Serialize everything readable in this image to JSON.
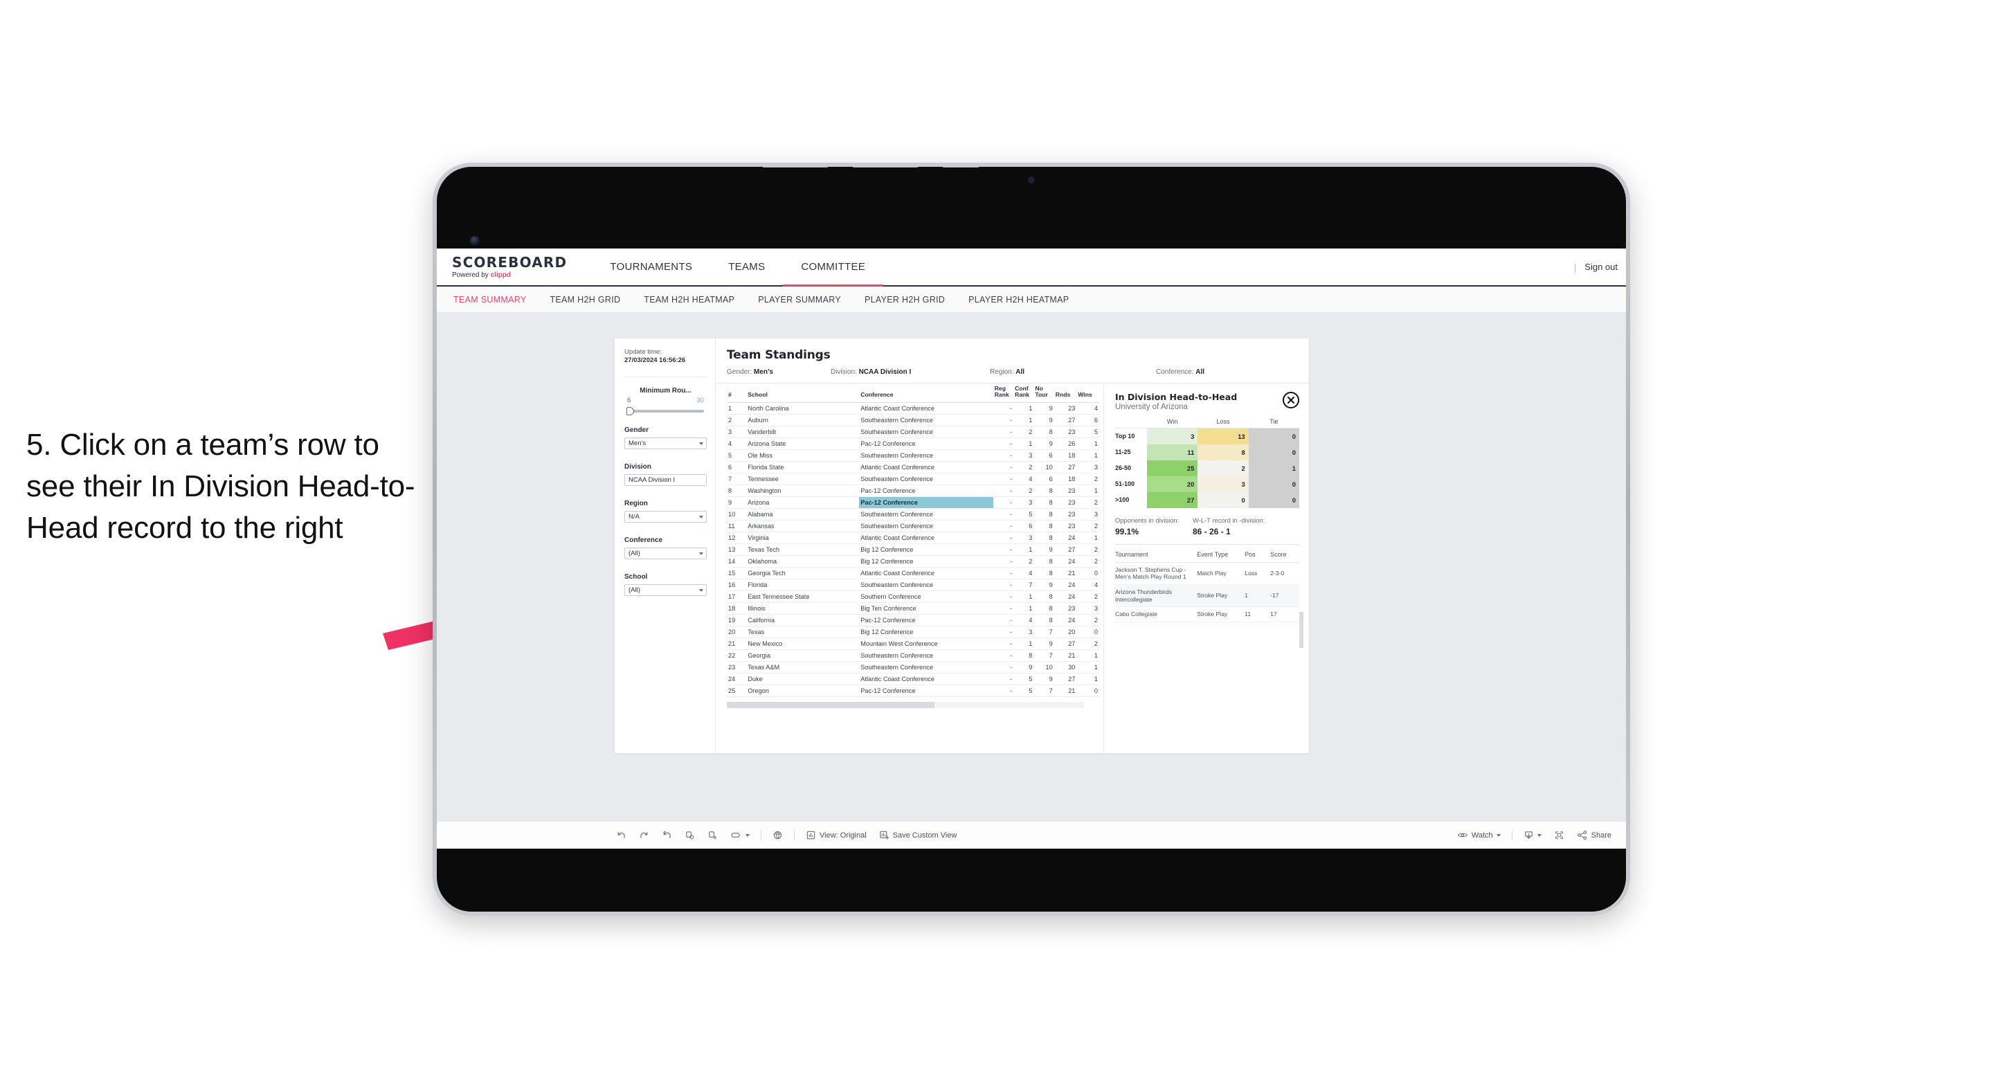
{
  "caption": "5. Click on a team’s row to see their In Division Head-to-Head record to the right",
  "app": {
    "brand": {
      "name": "SCOREBOARD",
      "powered_prefix": "Powered by ",
      "powered_by": "clippd"
    },
    "top_nav": [
      {
        "label": "TOURNAMENTS",
        "active": false
      },
      {
        "label": "TEAMS",
        "active": false
      },
      {
        "label": "COMMITTEE",
        "active": true
      }
    ],
    "sign_out": "Sign out",
    "sub_nav": [
      {
        "label": "TEAM SUMMARY",
        "active": true
      },
      {
        "label": "TEAM H2H GRID",
        "active": false
      },
      {
        "label": "TEAM H2H HEATMAP",
        "active": false
      },
      {
        "label": "PLAYER SUMMARY",
        "active": false
      },
      {
        "label": "PLAYER H2H GRID",
        "active": false
      },
      {
        "label": "PLAYER H2H HEATMAP",
        "active": false
      }
    ]
  },
  "filters": {
    "update_label": "Update time:",
    "update_time": "27/03/2024 16:56:26",
    "slider": {
      "title": "Minimum Rou...",
      "min": "6",
      "max": "30"
    },
    "fields": [
      {
        "label": "Gender",
        "value": "Men’s"
      },
      {
        "label": "Division",
        "value": "NCAA Division I"
      },
      {
        "label": "Region",
        "value": "N/A"
      },
      {
        "label": "Conference",
        "value": "(All)"
      },
      {
        "label": "School",
        "value": "(All)"
      }
    ]
  },
  "standings": {
    "title": "Team Standings",
    "meta": [
      {
        "label": "Gender: ",
        "value": "Men’s"
      },
      {
        "label": "Division: ",
        "value": "NCAA Division I"
      },
      {
        "label": "Region: ",
        "value": "All"
      },
      {
        "label": "Conference: ",
        "value": "All"
      }
    ],
    "columns": [
      "#",
      "School",
      "Conference",
      "Reg Rank",
      "Conf Rank",
      "No Tour",
      "Rnds",
      "Wins"
    ],
    "rows": [
      {
        "rank": "1",
        "school": "North Carolina",
        "conference": "Atlantic Coast Conference",
        "reg_rank": "-",
        "conf_rank": "1",
        "no_tour": "9",
        "rnds": "23",
        "wins": "4",
        "selected": false
      },
      {
        "rank": "2",
        "school": "Auburn",
        "conference": "Southeastern Conference",
        "reg_rank": "-",
        "conf_rank": "1",
        "no_tour": "9",
        "rnds": "27",
        "wins": "6",
        "selected": false
      },
      {
        "rank": "3",
        "school": "Vanderbilt",
        "conference": "Southeastern Conference",
        "reg_rank": "-",
        "conf_rank": "2",
        "no_tour": "8",
        "rnds": "23",
        "wins": "5",
        "selected": false
      },
      {
        "rank": "4",
        "school": "Arizona State",
        "conference": "Pac-12 Conference",
        "reg_rank": "-",
        "conf_rank": "1",
        "no_tour": "9",
        "rnds": "26",
        "wins": "1",
        "selected": false
      },
      {
        "rank": "5",
        "school": "Ole Miss",
        "conference": "Southeastern Conference",
        "reg_rank": "-",
        "conf_rank": "3",
        "no_tour": "6",
        "rnds": "18",
        "wins": "1",
        "selected": false
      },
      {
        "rank": "6",
        "school": "Florida State",
        "conference": "Atlantic Coast Conference",
        "reg_rank": "-",
        "conf_rank": "2",
        "no_tour": "10",
        "rnds": "27",
        "wins": "3",
        "selected": false
      },
      {
        "rank": "7",
        "school": "Tennessee",
        "conference": "Southeastern Conference",
        "reg_rank": "-",
        "conf_rank": "4",
        "no_tour": "6",
        "rnds": "18",
        "wins": "2",
        "selected": false
      },
      {
        "rank": "8",
        "school": "Washington",
        "conference": "Pac-12 Conference",
        "reg_rank": "-",
        "conf_rank": "2",
        "no_tour": "8",
        "rnds": "23",
        "wins": "1",
        "selected": false
      },
      {
        "rank": "9",
        "school": "Arizona",
        "conference": "Pac-12 Conference",
        "reg_rank": "-",
        "conf_rank": "3",
        "no_tour": "8",
        "rnds": "23",
        "wins": "2",
        "selected": true
      },
      {
        "rank": "10",
        "school": "Alabama",
        "conference": "Southeastern Conference",
        "reg_rank": "-",
        "conf_rank": "5",
        "no_tour": "8",
        "rnds": "23",
        "wins": "3",
        "selected": false
      },
      {
        "rank": "11",
        "school": "Arkansas",
        "conference": "Southeastern Conference",
        "reg_rank": "-",
        "conf_rank": "6",
        "no_tour": "8",
        "rnds": "23",
        "wins": "2",
        "selected": false
      },
      {
        "rank": "12",
        "school": "Virginia",
        "conference": "Atlantic Coast Conference",
        "reg_rank": "-",
        "conf_rank": "3",
        "no_tour": "8",
        "rnds": "24",
        "wins": "1",
        "selected": false
      },
      {
        "rank": "13",
        "school": "Texas Tech",
        "conference": "Big 12 Conference",
        "reg_rank": "-",
        "conf_rank": "1",
        "no_tour": "9",
        "rnds": "27",
        "wins": "2",
        "selected": false
      },
      {
        "rank": "14",
        "school": "Oklahoma",
        "conference": "Big 12 Conference",
        "reg_rank": "-",
        "conf_rank": "2",
        "no_tour": "8",
        "rnds": "24",
        "wins": "2",
        "selected": false
      },
      {
        "rank": "15",
        "school": "Georgia Tech",
        "conference": "Atlantic Coast Conference",
        "reg_rank": "-",
        "conf_rank": "4",
        "no_tour": "8",
        "rnds": "21",
        "wins": "0",
        "selected": false
      },
      {
        "rank": "16",
        "school": "Florida",
        "conference": "Southeastern Conference",
        "reg_rank": "-",
        "conf_rank": "7",
        "no_tour": "9",
        "rnds": "24",
        "wins": "4",
        "selected": false
      },
      {
        "rank": "17",
        "school": "East Tennessee State",
        "conference": "Southern Conference",
        "reg_rank": "-",
        "conf_rank": "1",
        "no_tour": "8",
        "rnds": "24",
        "wins": "2",
        "selected": false
      },
      {
        "rank": "18",
        "school": "Illinois",
        "conference": "Big Ten Conference",
        "reg_rank": "-",
        "conf_rank": "1",
        "no_tour": "8",
        "rnds": "23",
        "wins": "3",
        "selected": false
      },
      {
        "rank": "19",
        "school": "California",
        "conference": "Pac-12 Conference",
        "reg_rank": "-",
        "conf_rank": "4",
        "no_tour": "8",
        "rnds": "24",
        "wins": "2",
        "selected": false
      },
      {
        "rank": "20",
        "school": "Texas",
        "conference": "Big 12 Conference",
        "reg_rank": "-",
        "conf_rank": "3",
        "no_tour": "7",
        "rnds": "20",
        "wins": "0",
        "selected": false
      },
      {
        "rank": "21",
        "school": "New Mexico",
        "conference": "Mountain West Conference",
        "reg_rank": "-",
        "conf_rank": "1",
        "no_tour": "9",
        "rnds": "27",
        "wins": "2",
        "selected": false
      },
      {
        "rank": "22",
        "school": "Georgia",
        "conference": "Southeastern Conference",
        "reg_rank": "-",
        "conf_rank": "8",
        "no_tour": "7",
        "rnds": "21",
        "wins": "1",
        "selected": false
      },
      {
        "rank": "23",
        "school": "Texas A&M",
        "conference": "Southeastern Conference",
        "reg_rank": "-",
        "conf_rank": "9",
        "no_tour": "10",
        "rnds": "30",
        "wins": "1",
        "selected": false
      },
      {
        "rank": "24",
        "school": "Duke",
        "conference": "Atlantic Coast Conference",
        "reg_rank": "-",
        "conf_rank": "5",
        "no_tour": "9",
        "rnds": "27",
        "wins": "1",
        "selected": false
      },
      {
        "rank": "25",
        "school": "Oregon",
        "conference": "Pac-12 Conference",
        "reg_rank": "-",
        "conf_rank": "5",
        "no_tour": "7",
        "rnds": "21",
        "wins": "0",
        "selected": false
      }
    ]
  },
  "h2h": {
    "title": "In Division Head-to-Head",
    "subtitle": "University of Arizona",
    "close_icon": "close-circle-icon",
    "matrix_columns": [
      "Win",
      "Loss",
      "Tie"
    ],
    "matrix_rows": [
      {
        "label": "Top 10",
        "win": "3",
        "loss": "13",
        "tie": "0",
        "win_color": "#e2efdc",
        "loss_color": "#f2dd91",
        "tie_color": "#cfcfcf"
      },
      {
        "label": "11-25",
        "win": "11",
        "loss": "8",
        "tie": "0",
        "win_color": "#c5e4b4",
        "loss_color": "#f6eac6",
        "tie_color": "#cfcfcf"
      },
      {
        "label": "26-50",
        "win": "25",
        "loss": "2",
        "tie": "1",
        "win_color": "#8ed06a",
        "loss_color": "#f2f2ee",
        "tie_color": "#cfcfcf"
      },
      {
        "label": "51-100",
        "win": "20",
        "loss": "3",
        "tie": "0",
        "win_color": "#a7dc89",
        "loss_color": "#f4efe2",
        "tie_color": "#cfcfcf"
      },
      {
        "label": ">100",
        "win": "27",
        "loss": "0",
        "tie": "0",
        "win_color": "#8ed06a",
        "loss_color": "#f2f2ee",
        "tie_color": "#cfcfcf"
      }
    ],
    "stats": [
      {
        "label": "Opponents in division:",
        "value": "99.1%"
      },
      {
        "label": "W-L-T record in -division:",
        "value": "86 - 26 - 1"
      }
    ],
    "tournament_columns": [
      "Tournament",
      "Event Type",
      "Pos",
      "Score"
    ],
    "tournaments": [
      {
        "name": "Jackson T. Stephens Cup - Men’s Match Play Round 1",
        "event_type": "Match Play",
        "pos": "Loss",
        "score": "2-3-0"
      },
      {
        "name": "Arizona Thunderbirds Intercollegiate",
        "event_type": "Stroke Play",
        "pos": "1",
        "score": "-17"
      },
      {
        "name": "Cabo Collegiate",
        "event_type": "Stroke Play",
        "pos": "11",
        "score": "17"
      }
    ]
  },
  "toolbar": {
    "icons": [
      "undo-icon",
      "redo-icon",
      "revert-icon",
      "refresh-data-icon",
      "pause-updates-icon",
      "view-original-icon"
    ],
    "view_label": "View: Original",
    "save_label": "Save Custom View",
    "watch_label": "Watch",
    "share_label": "Share"
  },
  "colors": {
    "accent": "#e8456b",
    "selection": "#8dc8d8",
    "nav_dark": "#2b3040",
    "arrow": "#ee3264"
  }
}
